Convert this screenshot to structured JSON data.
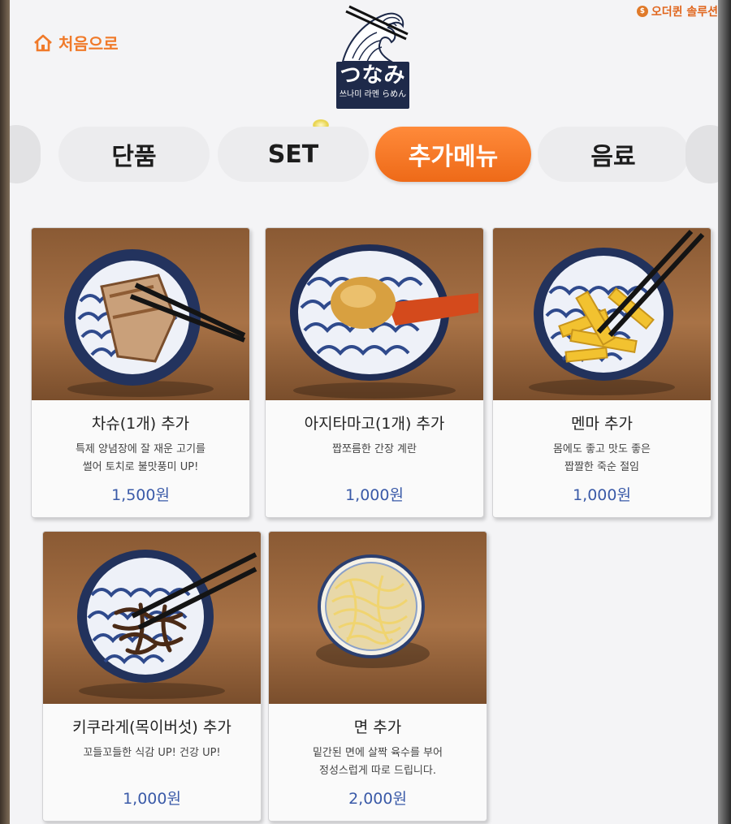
{
  "header": {
    "home_label": "처음으로",
    "brand_label": "오더퀸 솔루션",
    "logo_main": "つなみ",
    "logo_sub": "쓰나미 라멘 らめん"
  },
  "tabs": [
    {
      "label": "단품",
      "active": false
    },
    {
      "label": "SET",
      "active": false
    },
    {
      "label": "추가메뉴",
      "active": true
    },
    {
      "label": "음료",
      "active": false
    }
  ],
  "menu": [
    {
      "name": "차슈(1개) 추가",
      "desc": [
        "특제 양념장에 잘 재운 고기를",
        "썰어 토치로 불맛풍미 UP!"
      ],
      "price": "1,500원",
      "photo": "chashu-photo"
    },
    {
      "name": "아지타마고(1개) 추가",
      "desc": [
        "짭쪼름한 간장 계란"
      ],
      "price": "1,000원",
      "photo": "egg-photo"
    },
    {
      "name": "멘마 추가",
      "desc": [
        "몸에도 좋고 맛도 좋은",
        "짭짤한 죽순 절임"
      ],
      "price": "1,000원",
      "photo": "menma-photo"
    },
    {
      "name": "키쿠라게(목이버섯) 추가",
      "desc": [
        "꼬들꼬들한 식감 UP! 건강 UP!"
      ],
      "price": "1,000원",
      "photo": "kikurage-photo"
    },
    {
      "name": "면 추가",
      "desc": [
        "밑간된 면에 살짝 육수를 부어",
        "정성스럽게 따로 드립니다."
      ],
      "price": "2,000원",
      "photo": "noodle-photo"
    }
  ],
  "colors": {
    "accent": "#f07a2a",
    "price": "#3a5aa8",
    "logo_bg": "#1e2a4a"
  }
}
